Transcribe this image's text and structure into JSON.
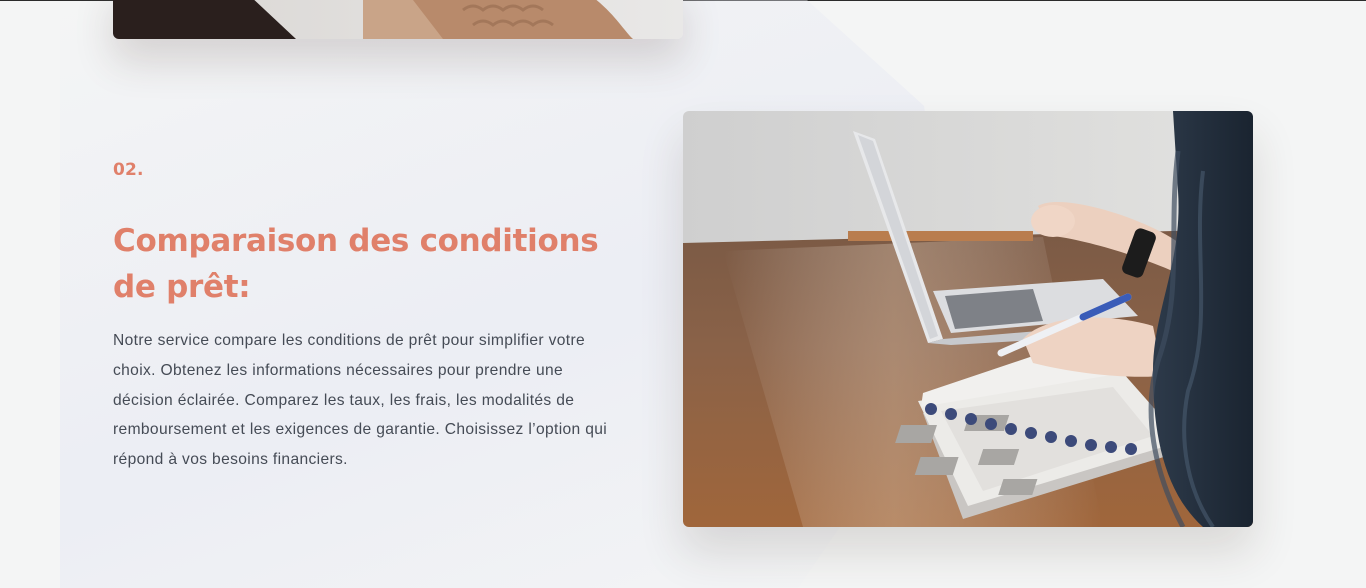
{
  "section": {
    "number": "02.",
    "title": "Comparaison des conditions de prêt:",
    "body": "Notre service compare les conditions de prêt pour simplifier votre choix. Obtenez les informations nécessaires pour prendre une décision éclairée. Comparez les taux, les frais, les modalités de remboursement et les exigences de garantie. Choisissez l’option qui répond à vos besoins financiers."
  },
  "images": {
    "top": "photo-previous-section",
    "main": "photo-notebook-laptop-desk"
  },
  "colors": {
    "accent": "#e0806a",
    "text": "#454b55",
    "background": "#f4f5f5"
  }
}
